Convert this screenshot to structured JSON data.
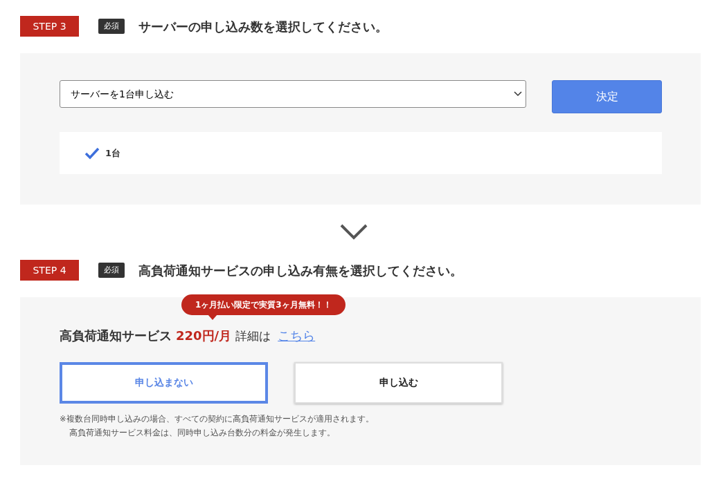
{
  "step3": {
    "step_label": "STEP 3",
    "required_badge": "必須",
    "title": "サーバーの申し込み数を選択してください。",
    "select": {
      "value": "サーバーを1台申し込む"
    },
    "confirm_button": "決定",
    "selected_items": [
      {
        "label": "1台",
        "checked": true
      }
    ]
  },
  "step4": {
    "step_label": "STEP 4",
    "required_badge": "必須",
    "title": "高負荷通知サービスの申し込み有無を選択してください。",
    "promo_bubble": "1ヶ月払い限定で実質3ヶ月無料！！",
    "service_name": "高負荷通知サービス",
    "price": "220円/月",
    "details_label": "詳細は",
    "details_link": "こちら",
    "options": [
      {
        "label": "申し込まない",
        "selected": true
      },
      {
        "label": "申し込む",
        "selected": false
      }
    ],
    "notes": [
      "※複数台同時申し込みの場合、すべての契約に高負荷通知サービスが適用されます。",
      "高負荷通知サービス料金は、同時申し込み台数分の料金が発生します。"
    ]
  }
}
